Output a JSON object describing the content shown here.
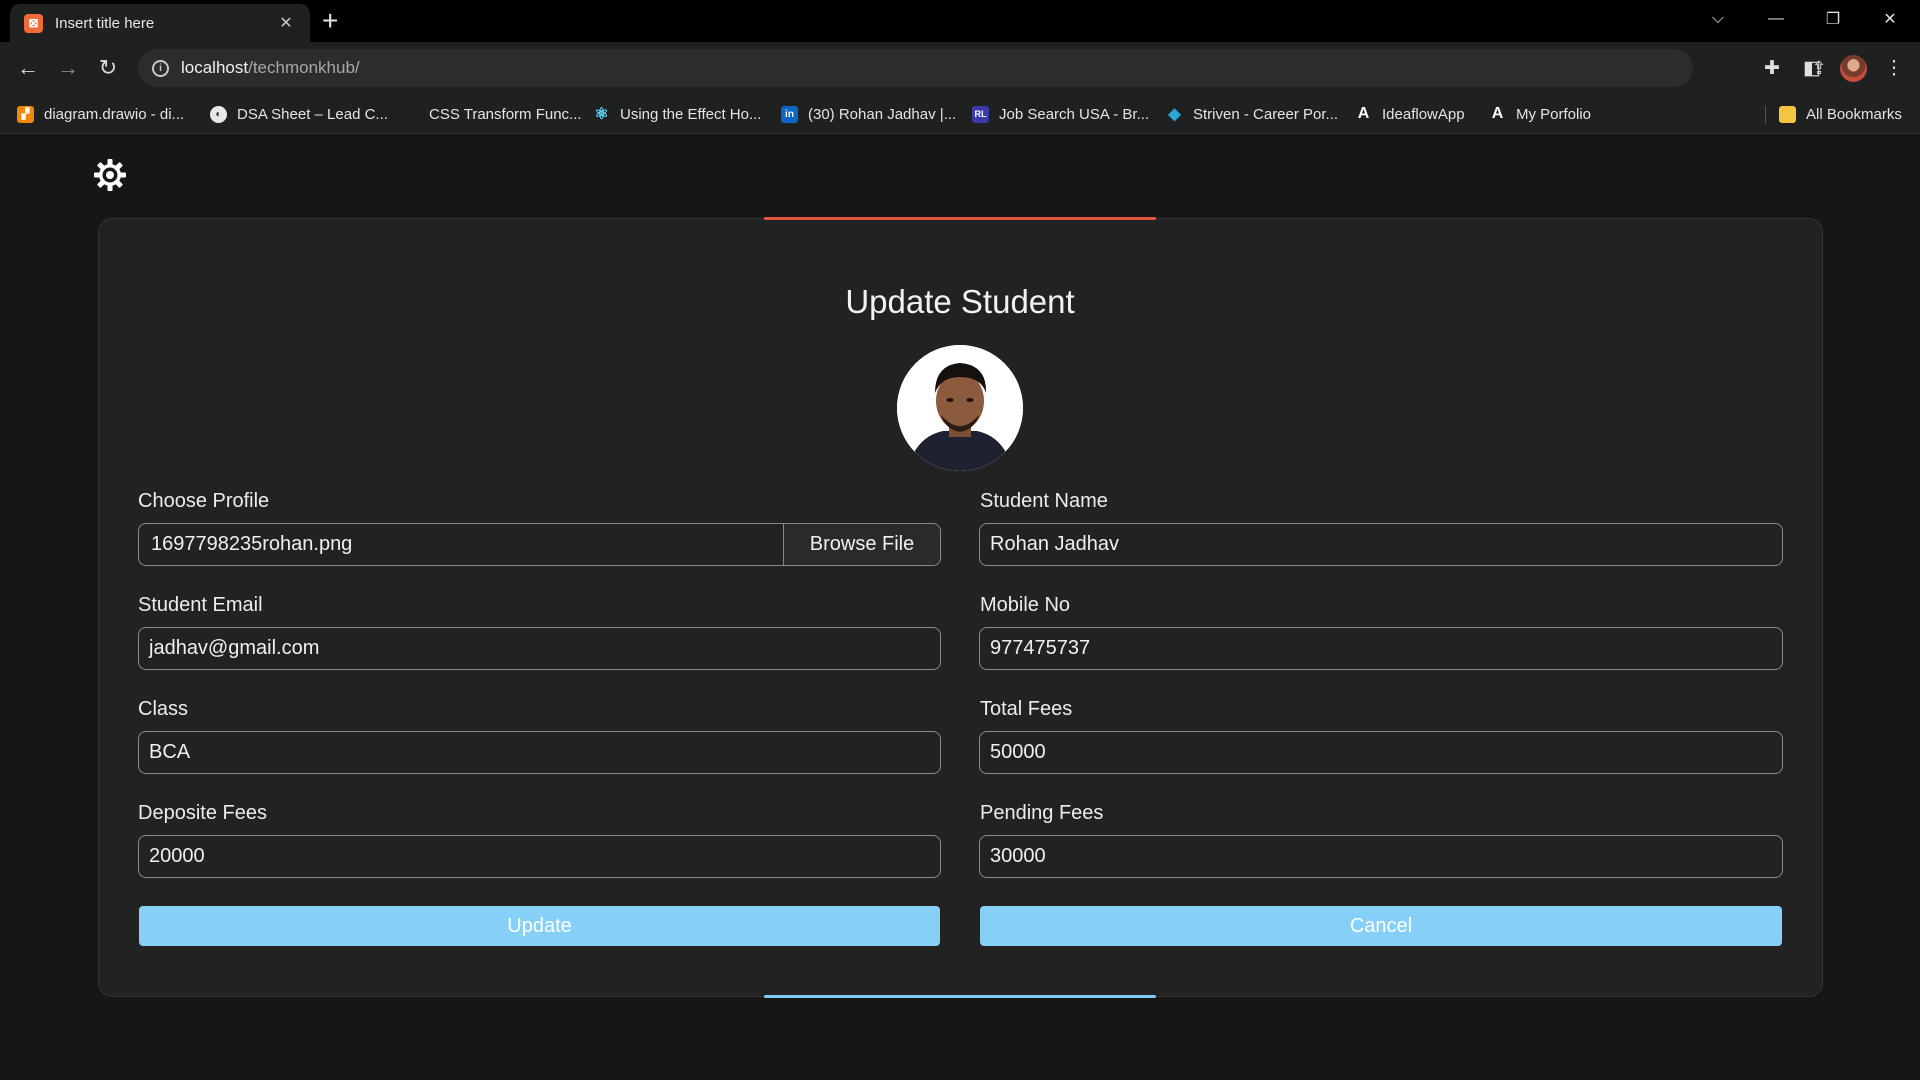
{
  "browser": {
    "tab_title": "Insert title here",
    "tab_favicon": "xampp-icon",
    "url_host": "localhost",
    "url_path": "/techmonkhub/",
    "bookmarks": [
      {
        "label": "diagram.drawio - di...",
        "icon": "drawio-icon",
        "color": "#f08705"
      },
      {
        "label": "DSA Sheet – Lead C...",
        "icon": "globe-icon",
        "color": "#ffffff"
      },
      {
        "label": "CSS Transform Func...",
        "icon": "blank-icon",
        "color": "#1f2020"
      },
      {
        "label": "Using the Effect Ho...",
        "icon": "react-icon",
        "color": "#61dafb"
      },
      {
        "label": "(30) Rohan Jadhav |...",
        "icon": "linkedin-icon",
        "color": "#0a66c2"
      },
      {
        "label": "Job Search USA - Br...",
        "icon": "rl-icon",
        "color": "#3a3aa8"
      },
      {
        "label": "Striven - Career Por...",
        "icon": "striven-icon",
        "color": "#2aa7d8"
      },
      {
        "label": "IdeaflowApp",
        "icon": "ideaflow-icon",
        "color": "#ffffff"
      },
      {
        "label": "My Porfolio",
        "icon": "ideaflow-icon",
        "color": "#ffffff"
      }
    ],
    "all_bookmarks": "All Bookmarks"
  },
  "page": {
    "title": "Update Student",
    "accent_colors": {
      "top": "#e5553e",
      "bottom": "#7dcbf2",
      "button": "#86cff7"
    },
    "fields": {
      "profile": {
        "label": "Choose Profile",
        "value": "1697798235rohan.png",
        "button": "Browse File"
      },
      "name": {
        "label": "Student Name",
        "value": "Rohan Jadhav"
      },
      "email": {
        "label": "Student Email",
        "value": "jadhav@gmail.com"
      },
      "mobile": {
        "label": "Mobile No",
        "value": "977475737"
      },
      "class": {
        "label": "Class",
        "value": "BCA"
      },
      "total_fees": {
        "label": "Total Fees",
        "value": "50000"
      },
      "deposite_fees": {
        "label": "Deposite Fees",
        "value": "20000"
      },
      "pending_fees": {
        "label": "Pending Fees",
        "value": "30000"
      }
    },
    "buttons": {
      "update": "Update",
      "cancel": "Cancel"
    }
  }
}
